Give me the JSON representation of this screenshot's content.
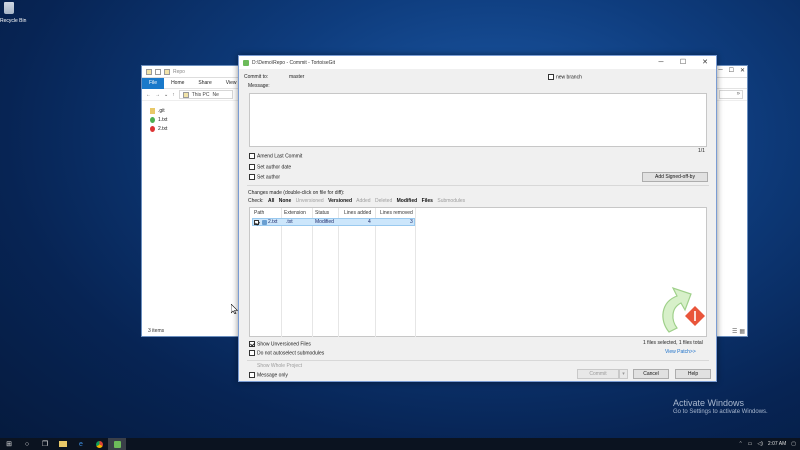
{
  "desktop": {
    "recycle_bin_label": "Recycle Bin"
  },
  "explorer": {
    "title": "Repo",
    "tabs": [
      "File",
      "Home",
      "Share",
      "View"
    ],
    "breadcrumb": [
      "This PC",
      "Ne"
    ],
    "files": [
      {
        "name": ".git",
        "icon": "folder-icon"
      },
      {
        "name": "1.txt",
        "icon": "text-file-icon"
      },
      {
        "name": "2.txt",
        "icon": "modified-file-icon"
      }
    ],
    "status": "3 items",
    "search_chevron": "»"
  },
  "dialog": {
    "title": "D:\\Demo\\Repo - Commit - TortoiseGit",
    "commit_to_label": "Commit to:",
    "branch": "master",
    "new_branch_label": "new branch",
    "message_label": "Message:",
    "message_value": "",
    "line_counter": "1/1",
    "amend_label": "Amend Last Commit",
    "set_author_date_label": "Set author date",
    "set_author_label": "Set author",
    "add_signed_off_label": "Add Signed-off-by",
    "changes_label": "Changes made (double-click on file for diff):",
    "check_label": "Check:",
    "filters": [
      {
        "label": "All",
        "state": "bold"
      },
      {
        "label": "None",
        "state": "bold"
      },
      {
        "label": "Unversioned",
        "state": "gray"
      },
      {
        "label": "Versioned",
        "state": "bold"
      },
      {
        "label": "Added",
        "state": "gray"
      },
      {
        "label": "Deleted",
        "state": "gray"
      },
      {
        "label": "Modified",
        "state": "bold"
      },
      {
        "label": "Files",
        "state": "bold"
      },
      {
        "label": "Submodules",
        "state": "gray"
      }
    ],
    "columns": [
      "Path",
      "Extension",
      "Status",
      "Lines added",
      "Lines removed"
    ],
    "rows": [
      {
        "path": "2.txt",
        "extension": ".txt",
        "status": "Modified",
        "lines_added": "4",
        "lines_removed": "3",
        "checked": true
      }
    ],
    "show_unversioned_label": "Show Unversioned Files",
    "no_autoselect_label": "Do not autoselect submodules",
    "selection_summary": "1 files selected, 1 files total",
    "view_patch_label": "View Patch>>",
    "show_whole_project_label": "Show Whole Project",
    "message_only_label": "Message only",
    "commit_label": "Commit",
    "dropdown_arrow": "▾",
    "cancel_label": "Cancel",
    "help_label": "Help",
    "accent_color": "#1a6fc9",
    "window_controls": [
      "─",
      "☐",
      "✕"
    ]
  },
  "watermark": {
    "title": "Activate Windows",
    "subtitle": "Go to Settings to activate Windows."
  },
  "taskbar": {
    "time": "2:07 AM",
    "icons": [
      "windows-start-icon",
      "search-icon",
      "task-view-icon",
      "file-explorer-icon",
      "edge-icon",
      "chrome-icon",
      "tortoisegit-icon"
    ]
  }
}
